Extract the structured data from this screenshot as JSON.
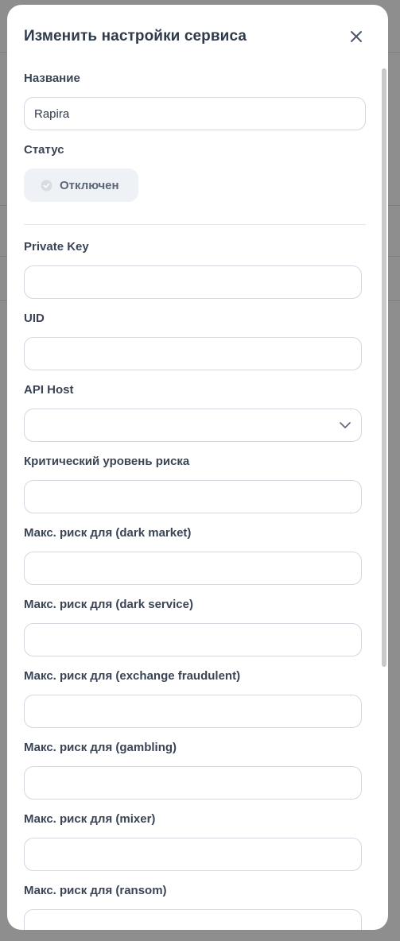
{
  "modal": {
    "title": "Изменить настройки сервиса"
  },
  "fields": {
    "name": {
      "label": "Название",
      "value": "Rapira"
    },
    "status": {
      "label": "Статус",
      "value": "Отключен"
    },
    "private_key": {
      "label": "Private Key",
      "value": ""
    },
    "uid": {
      "label": "UID",
      "value": ""
    },
    "api_host": {
      "label": "API Host",
      "value": ""
    },
    "critical_risk": {
      "label": "Критический уровень риска",
      "value": ""
    },
    "risk_dark_market": {
      "label": "Макс. риск для (dark market)",
      "value": ""
    },
    "risk_dark_service": {
      "label": "Макс. риск для (dark service)",
      "value": ""
    },
    "risk_exchange_fraudulent": {
      "label": "Макс. риск для (exchange fraudulent)",
      "value": ""
    },
    "risk_gambling": {
      "label": "Макс. риск для (gambling)",
      "value": ""
    },
    "risk_mixer": {
      "label": "Макс. риск для (mixer)",
      "value": ""
    },
    "risk_ransom": {
      "label": "Макс. риск для (ransom)",
      "value": ""
    }
  },
  "icons": {
    "close": "close-icon",
    "status": "check-circle-icon",
    "select": "chevron-down-icon"
  },
  "colors": {
    "overlay": "#8e8e8e",
    "title": "#2f3a4a",
    "label": "#3a4454",
    "input_border": "#d3d7de",
    "chip_bg": "#eef1f5"
  }
}
